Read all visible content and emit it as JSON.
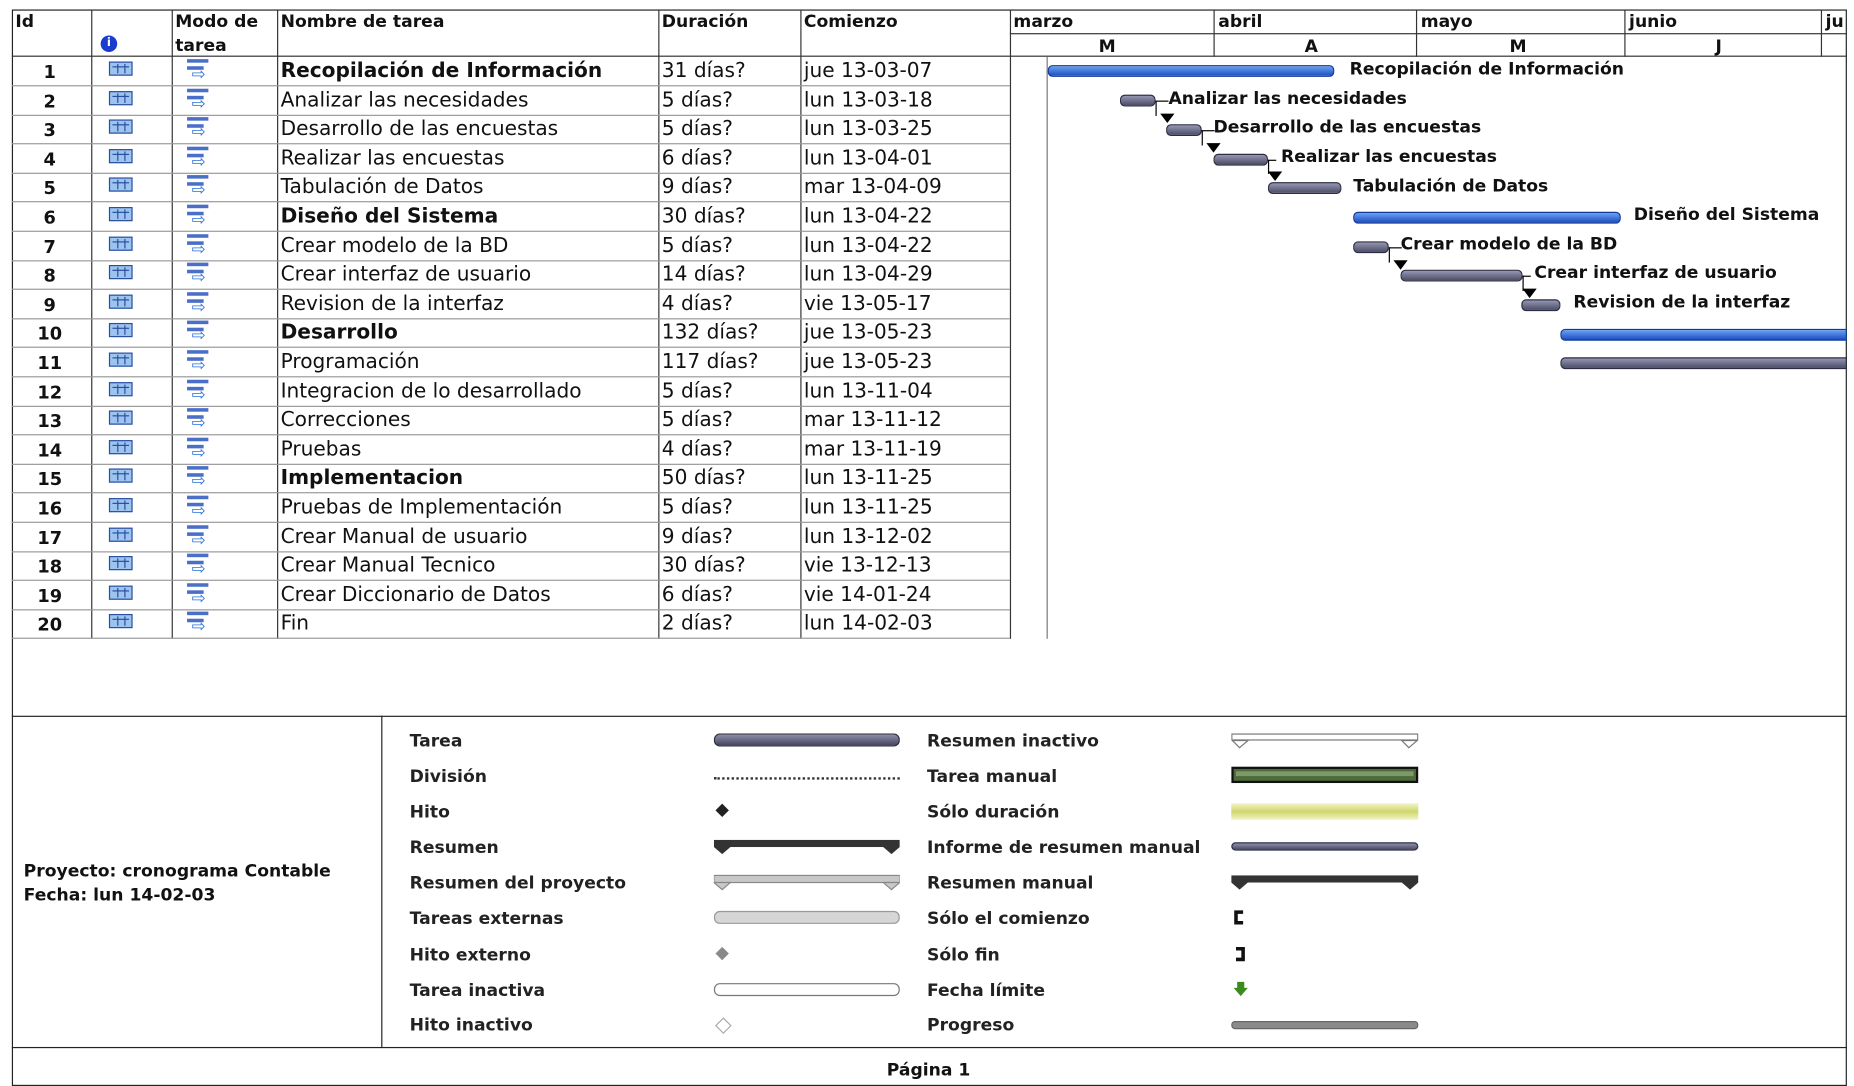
{
  "columns": {
    "id": "Id",
    "mode_line1": "Modo de",
    "mode_line2": "tarea",
    "name": "Nombre de tarea",
    "duration": "Duración",
    "start": "Comienzo",
    "info_icon": "info-icon"
  },
  "timescale": {
    "months": [
      "marzo",
      "abril",
      "mayo",
      "junio",
      "ju"
    ],
    "minor": [
      "M",
      "A",
      "M",
      "J"
    ]
  },
  "tasks": [
    {
      "id": "1",
      "name": "Recopilación de Información",
      "duration": "31 días?",
      "start": "jue 13-03-07",
      "summary": true
    },
    {
      "id": "2",
      "name": "Analizar las necesidades",
      "duration": "5 días?",
      "start": "lun 13-03-18",
      "summary": false
    },
    {
      "id": "3",
      "name": "Desarrollo de las encuestas",
      "duration": "5 días?",
      "start": "lun 13-03-25",
      "summary": false
    },
    {
      "id": "4",
      "name": "Realizar las encuestas",
      "duration": "6 días?",
      "start": "lun 13-04-01",
      "summary": false
    },
    {
      "id": "5",
      "name": "Tabulación de Datos",
      "duration": "9 días?",
      "start": "mar 13-04-09",
      "summary": false
    },
    {
      "id": "6",
      "name": "Diseño del Sistema",
      "duration": "30 días?",
      "start": "lun 13-04-22",
      "summary": true
    },
    {
      "id": "7",
      "name": "Crear modelo de la BD",
      "duration": "5 días?",
      "start": "lun 13-04-22",
      "summary": false
    },
    {
      "id": "8",
      "name": "Crear interfaz de usuario",
      "duration": "14 días?",
      "start": "lun 13-04-29",
      "summary": false
    },
    {
      "id": "9",
      "name": "Revision de la interfaz",
      "duration": "4 días?",
      "start": "vie 13-05-17",
      "summary": false
    },
    {
      "id": "10",
      "name": "Desarrollo",
      "duration": "132 días?",
      "start": "jue 13-05-23",
      "summary": true
    },
    {
      "id": "11",
      "name": "Programación",
      "duration": "117 días?",
      "start": "jue 13-05-23",
      "summary": false
    },
    {
      "id": "12",
      "name": "Integracion de lo desarrollado",
      "duration": "5 días?",
      "start": "lun 13-11-04",
      "summary": false
    },
    {
      "id": "13",
      "name": "Correcciones",
      "duration": "5 días?",
      "start": "mar 13-11-12",
      "summary": false
    },
    {
      "id": "14",
      "name": "Pruebas",
      "duration": "4 días?",
      "start": "mar 13-11-19",
      "summary": false
    },
    {
      "id": "15",
      "name": "Implementacion",
      "duration": "50 días?",
      "start": "lun 13-11-25",
      "summary": true
    },
    {
      "id": "16",
      "name": "Pruebas de Implementación",
      "duration": "5 días?",
      "start": "lun 13-11-25",
      "summary": false
    },
    {
      "id": "17",
      "name": "Crear Manual de usuario",
      "duration": "9 días?",
      "start": "lun 13-12-02",
      "summary": false
    },
    {
      "id": "18",
      "name": "Crear Manual Tecnico",
      "duration": "30 días?",
      "start": "vie 13-12-13",
      "summary": false
    },
    {
      "id": "19",
      "name": "Crear Diccionario de Datos",
      "duration": "6 días?",
      "start": "vie 14-01-24",
      "summary": false
    },
    {
      "id": "20",
      "name": "Fin",
      "duration": "2 días?",
      "start": "lun 14-02-03",
      "summary": false
    }
  ],
  "gantt_labels": [
    "Recopilación de Información",
    "Analizar las necesidades",
    "Desarrollo de las encuestas",
    "Realizar las encuestas",
    "Tabulación de Datos",
    "Diseño del Sistema",
    "Crear modelo de la BD",
    "Crear interfaz de usuario",
    "Revision de la interfaz"
  ],
  "project_info": {
    "project": "Proyecto: cronograma Contable",
    "date": "Fecha: lun 14-02-03"
  },
  "legend": {
    "left": [
      "Tarea",
      "División",
      "Hito",
      "Resumen",
      "Resumen del proyecto",
      "Tareas externas",
      "Hito externo",
      "Tarea inactiva",
      "Hito inactivo"
    ],
    "right": [
      "Resumen inactivo",
      "Tarea manual",
      "Sólo duración",
      "Informe de resumen manual",
      "Resumen manual",
      "Sólo el comienzo",
      "Sólo fin",
      "Fecha límite",
      "Progreso"
    ]
  },
  "page_footer": "Página 1",
  "colors": {
    "task_bar": "#5a5c78",
    "summary_bar": "#2f63d6",
    "manual_task": "#4d6b3c",
    "duration_only": "#d8dd7a",
    "deadline": "#3a8a1c"
  }
}
